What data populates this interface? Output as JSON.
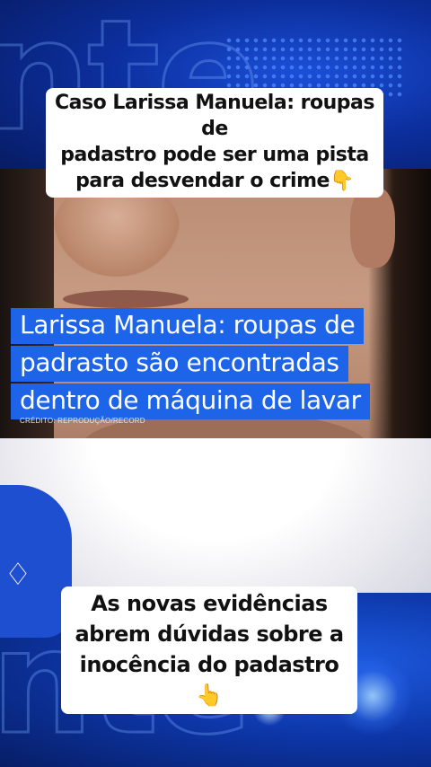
{
  "caption_top": {
    "line1": "Caso Larissa Manuela: roupas de",
    "line2": "padastro pode ser uma pista",
    "line3": "para desvendar o crime👇"
  },
  "headline": {
    "line1": "Larissa Manuela: roupas de",
    "line2": "padrasto são encontradas",
    "line3": "dentro de máquina de lavar"
  },
  "credit": "CRÉDITO: REPRODUÇÃO/RECORD",
  "caption_bottom": {
    "line1": "As novas evidências",
    "line2": "abrem dúvidas sobre a",
    "line3": "inocência do padastro 👆"
  },
  "colors": {
    "headline_bg": "#1d64e8",
    "studio_blue": "#0c2f9e"
  }
}
